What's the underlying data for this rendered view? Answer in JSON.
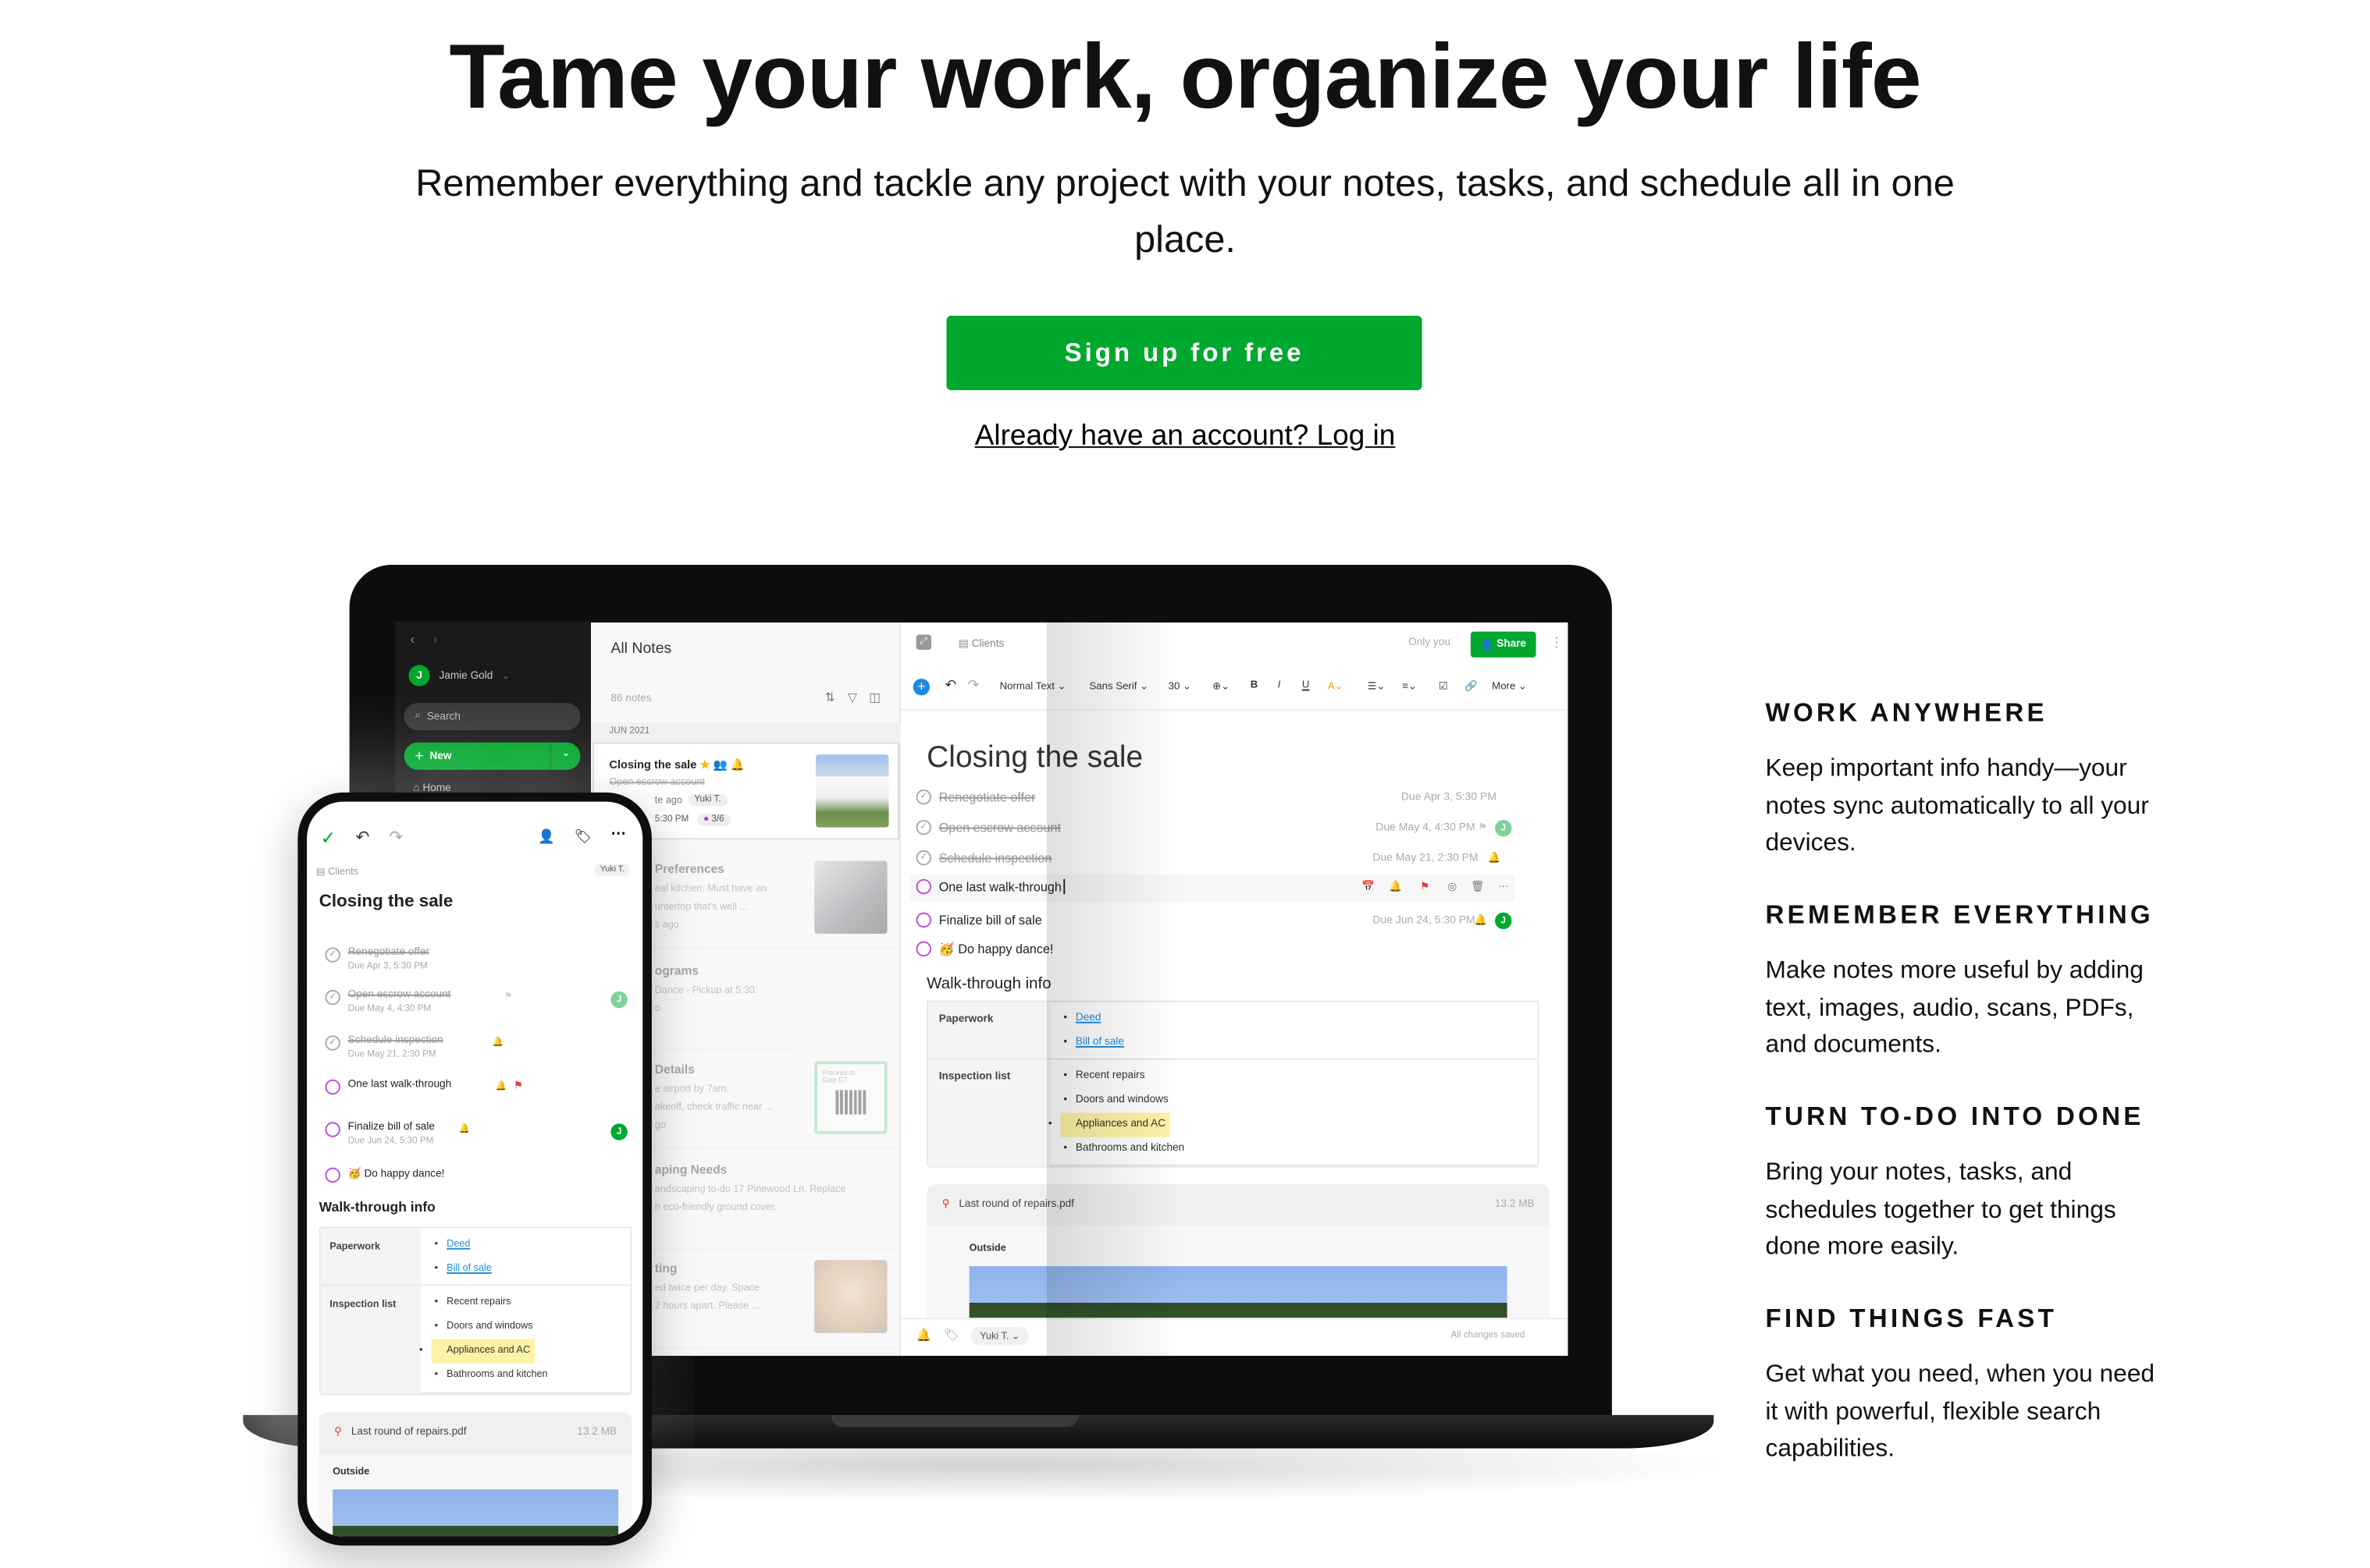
{
  "hero": {
    "title": "Tame your work, organize your life",
    "subtitle": "Remember everything and tackle any project with your notes, tasks, and schedule all in one place.",
    "cta": "Sign up for free",
    "login": "Already have an account? Log in"
  },
  "colors": {
    "brand": "#00a82d",
    "task_circle": "#b950d8",
    "link": "#1a8ce0",
    "highlight": "#fdf3a6"
  },
  "features": [
    {
      "heading": "WORK ANYWHERE",
      "body": "Keep important info handy—your notes sync automatically to all your devices."
    },
    {
      "heading": "REMEMBER EVERYTHING",
      "body": "Make notes more useful by adding text, images, audio, scans, PDFs, and documents."
    },
    {
      "heading": "TURN TO-DO INTO DONE",
      "body": "Bring your notes, tasks, and schedules together to get things done more easily."
    },
    {
      "heading": "FIND THINGS FAST",
      "body": "Get what you need, when you need it with powerful, flexible search capabilities."
    }
  ],
  "app": {
    "sidebar": {
      "avatar": "J",
      "user": "Jamie Gold",
      "search": "Search",
      "new": "New",
      "home": "Home"
    },
    "notes_list": {
      "title": "All Notes",
      "count": "86 notes",
      "group": "JUN 2021",
      "selected": {
        "title": "Closing the sale",
        "line": "Open escrow account",
        "time": "te ago",
        "tag": "Yuki T.",
        "reminder": "5:30 PM",
        "tasks": "3/6"
      },
      "notes": [
        {
          "title": "Preferences",
          "lines": [
            "eal kitchen. Must have an",
            "untertop that's well ...",
            "s ago"
          ]
        },
        {
          "title": "ograms",
          "lines": [
            "Dance - Pickup at 5:30.",
            "o"
          ]
        },
        {
          "title": "Details",
          "lines": [
            "e airport by 7am.",
            "akeoff, check traffic near ...",
            "go"
          ],
          "ticket": [
            "Proceed to",
            "Gate E7"
          ]
        },
        {
          "title": "aping Needs",
          "lines": [
            "andscaping to-do 17 Pinewood Ln. Replace",
            "h eco-friendly ground cover."
          ]
        },
        {
          "title": "ting",
          "lines": [
            "ed twice per day. Space",
            "2 hours apart. Please ..."
          ]
        }
      ]
    },
    "editor": {
      "breadcrumb": "Clients",
      "sharing": "Only you",
      "share": "Share",
      "toolbar": {
        "style": "Normal Text",
        "font": "Sans Serif",
        "size": "30",
        "more": "More"
      },
      "title": "Closing the sale",
      "tasks": [
        {
          "label": "Renegotiate offer",
          "due": "Due Apr 3, 5:30 PM",
          "done": true
        },
        {
          "label": "Open escrow account",
          "due": "Due May 4, 4:30 PM",
          "done": true,
          "assignee": "J"
        },
        {
          "label": "Schedule inspection",
          "due": "Due May 21, 2:30 PM",
          "done": true
        },
        {
          "label": "One last walk-through",
          "due": "",
          "done": false,
          "active": true
        },
        {
          "label": "Finalize bill of sale",
          "due": "Due Jun 24, 5:30 PM",
          "done": false,
          "assignee": "J"
        },
        {
          "label": "Do happy dance!",
          "due": "",
          "done": false,
          "emoji": "🥳"
        }
      ],
      "section": "Walk-through info",
      "table": [
        {
          "label": "Paperwork",
          "items": [
            {
              "text": "Deed",
              "link": true
            },
            {
              "text": "Bill of sale",
              "link": true
            }
          ]
        },
        {
          "label": "Inspection list",
          "items": [
            {
              "text": "Recent repairs"
            },
            {
              "text": "Doors and windows"
            },
            {
              "text": "Appliances and AC",
              "highlight": true
            },
            {
              "text": "Bathrooms and kitchen"
            }
          ]
        }
      ],
      "attachment": {
        "name": "Last round of repairs.pdf",
        "size": "13.2 MB",
        "caption": "Outside"
      },
      "footer": {
        "user": "Yuki T.",
        "status": "All changes saved"
      }
    },
    "phone": {
      "breadcrumb": "Clients",
      "user": "Yuki T."
    }
  }
}
